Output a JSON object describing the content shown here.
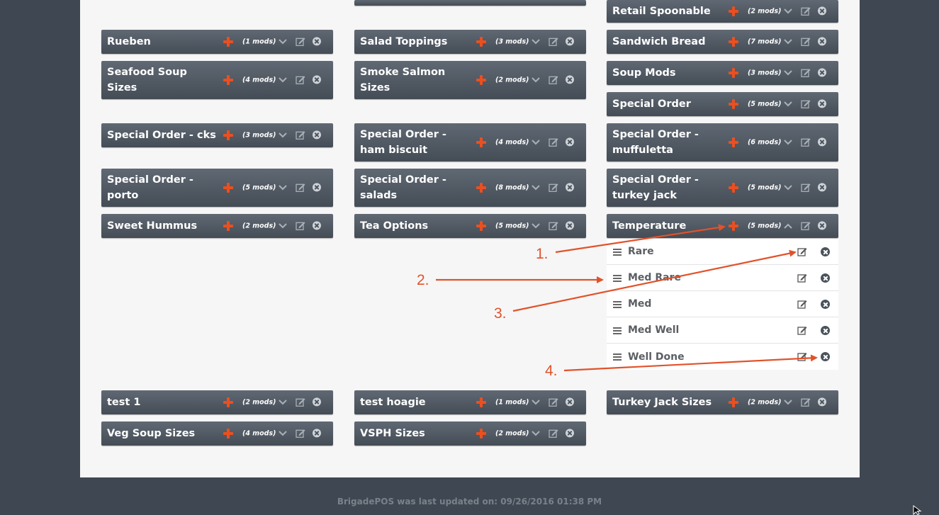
{
  "accent_color": "#ec4f1f",
  "groups": [
    {
      "label": "",
      "mods": "",
      "has_expand": true
    },
    {
      "label": "Retail Spoonable",
      "mods": "(2 mods)"
    },
    {
      "label": "Rueben",
      "mods": "(1 mods)"
    },
    {
      "label": "Salad Toppings",
      "mods": "(3 mods)"
    },
    {
      "label": "Sandwich Bread",
      "mods": "(7 mods)"
    },
    {
      "label": "Seafood Soup Sizes",
      "mods": "(4 mods)"
    },
    {
      "label": "Smoke Salmon Sizes",
      "mods": "(2 mods)"
    },
    {
      "label": "Soup Mods",
      "mods": "(3 mods)"
    },
    {
      "label": "Special Order",
      "mods": "(5 mods)"
    },
    {
      "label": "Special Order - cks",
      "mods": "(3 mods)"
    },
    {
      "label": "Special Order - ham biscuit",
      "mods": "(4 mods)"
    },
    {
      "label": "Special Order - muffuletta",
      "mods": "(6 mods)"
    },
    {
      "label": "Special Order - porto",
      "mods": "(5 mods)"
    },
    {
      "label": "Special Order - salads",
      "mods": "(8 mods)"
    },
    {
      "label": "Special Order - turkey jack",
      "mods": "(5 mods)"
    },
    {
      "label": "Sweet Hummus",
      "mods": "(2 mods)"
    },
    {
      "label": "Tea Options",
      "mods": "(5 mods)"
    },
    {
      "label": "Temperature",
      "mods": "(5 mods)",
      "expanded": true
    },
    {
      "label": "test 1",
      "mods": "(2 mods)"
    },
    {
      "label": "test hoagie",
      "mods": "(1 mods)"
    },
    {
      "label": "Turkey Jack Sizes",
      "mods": "(2 mods)"
    },
    {
      "label": "Veg Soup Sizes",
      "mods": "(4 mods)"
    },
    {
      "label": "VSPH Sizes",
      "mods": "(2 mods)"
    }
  ],
  "temperature_mods": [
    "Rare",
    "Med Rare",
    "Med",
    "Med Well",
    "Well Done"
  ],
  "annotations": [
    "1.",
    "2.",
    "3.",
    "4."
  ],
  "footer": "BrigadePOS was last updated on: 09/26/2016 01:38 PM"
}
